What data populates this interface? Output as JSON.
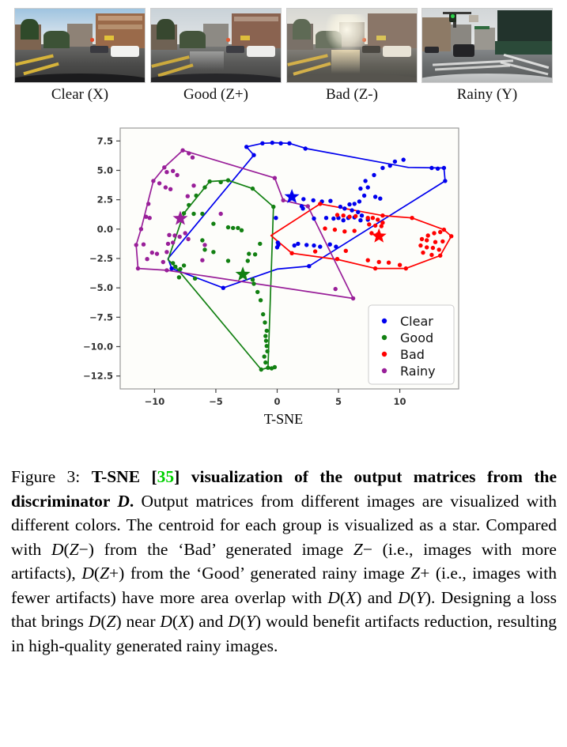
{
  "figure": {
    "label": "Figure 3:",
    "caption_bold": "T-SNE [35] visualization of the output matrices from the discriminator D.",
    "citation": "35",
    "caption_rest": "Output matrices from different images are visualized with different colors. The centroid for each group is visualized as a star. Compared with D(Z-) from the 'Bad' generated image Z- (i.e., images with more artifacts), D(Z+) from the 'Good' generated rainy image Z+ (i.e., images with fewer artifacts) have more area overlap with D(X) and D(Y). Designing a loss that brings D(Z) near D(X) and D(Y) would benefit artifacts reduction, resulting in high-quality generated rainy images."
  },
  "thumbnails": [
    {
      "label": "Clear (X)",
      "scene": "clear-daylight-city-street"
    },
    {
      "label": "Good (Z+)",
      "scene": "good-generated-rainy-street"
    },
    {
      "label": "Bad (Z-)",
      "scene": "bad-generated-rainy-street-artifacts"
    },
    {
      "label": "Rainy (Y)",
      "scene": "real-rainy-city-intersection"
    }
  ],
  "colors": {
    "clear": "#0000ee",
    "good": "#128012",
    "bad": "#ff0000",
    "rainy": "#991f99",
    "axis": "#444444",
    "frame": "#9a9a9a",
    "citation": "#00d000"
  },
  "chart_data": {
    "type": "scatter",
    "title": "",
    "xlabel": "T-SNE",
    "ylabel": "",
    "xlim": [
      -12.8,
      14.8
    ],
    "ylim": [
      -13.6,
      8.6
    ],
    "xticks": [
      -10,
      -5,
      0,
      5,
      10
    ],
    "yticks": [
      7.5,
      5.0,
      2.5,
      0.0,
      -2.5,
      -5.0,
      -7.5,
      -10.0,
      -12.5
    ],
    "grid": false,
    "legend_position": "lower right",
    "legend": [
      "Clear",
      "Good",
      "Bad",
      "Rainy"
    ],
    "series": [
      {
        "name": "Clear",
        "color": "#0000ee",
        "marker": "circle",
        "centroid": [
          1.2,
          2.75
        ],
        "hull": [
          [
            -1.9,
            6.3
          ],
          [
            -2.5,
            7.0
          ],
          [
            -1.2,
            7.3
          ],
          [
            -0.2,
            7.35
          ],
          [
            1.0,
            7.3
          ],
          [
            2.4,
            6.85
          ],
          [
            10.7,
            5.25
          ],
          [
            13.6,
            5.2
          ],
          [
            13.7,
            4.1
          ],
          [
            2.6,
            -3.15
          ],
          [
            0.0,
            -3.4
          ],
          [
            -4.4,
            -5.0
          ],
          [
            -8.6,
            -3.35
          ],
          [
            -8.9,
            -2.5
          ]
        ],
        "points": [
          [
            -2.5,
            7.0
          ],
          [
            -1.9,
            6.3
          ],
          [
            -1.2,
            7.3
          ],
          [
            -0.4,
            7.35
          ],
          [
            0.3,
            7.3
          ],
          [
            1.0,
            7.3
          ],
          [
            2.3,
            6.85
          ],
          [
            7.9,
            4.6
          ],
          [
            8.6,
            5.2
          ],
          [
            9.2,
            5.4
          ],
          [
            9.6,
            5.75
          ],
          [
            10.3,
            5.9
          ],
          [
            12.6,
            5.2
          ],
          [
            13.1,
            5.15
          ],
          [
            13.6,
            5.2
          ],
          [
            13.7,
            4.1
          ],
          [
            6.8,
            3.45
          ],
          [
            7.2,
            4.1
          ],
          [
            7.4,
            3.55
          ],
          [
            7.1,
            2.85
          ],
          [
            8.0,
            2.75
          ],
          [
            8.4,
            2.6
          ],
          [
            6.7,
            2.35
          ],
          [
            6.3,
            2.15
          ],
          [
            5.9,
            2.1
          ],
          [
            2.15,
            2.55
          ],
          [
            2.95,
            2.45
          ],
          [
            3.65,
            2.35
          ],
          [
            4.35,
            2.4
          ],
          [
            2.0,
            1.95
          ],
          [
            2.1,
            1.75
          ],
          [
            5.15,
            1.9
          ],
          [
            5.5,
            1.75
          ],
          [
            6.1,
            1.6
          ],
          [
            6.6,
            1.45
          ],
          [
            4.0,
            0.95
          ],
          [
            4.6,
            0.9
          ],
          [
            5.0,
            0.95
          ],
          [
            5.4,
            0.75
          ],
          [
            5.8,
            0.95
          ],
          [
            6.3,
            1.0
          ],
          [
            6.9,
            1.15
          ],
          [
            6.8,
            0.75
          ],
          [
            7.4,
            0.8
          ],
          [
            3.0,
            0.9
          ],
          [
            -0.1,
            0.95
          ],
          [
            0.1,
            -1.35
          ],
          [
            0.0,
            -1.55
          ],
          [
            0.05,
            -1.15
          ],
          [
            1.4,
            -1.4
          ],
          [
            1.7,
            -1.25
          ],
          [
            2.4,
            -1.35
          ],
          [
            3.0,
            -1.4
          ],
          [
            3.5,
            -1.5
          ],
          [
            4.3,
            -1.3
          ],
          [
            4.8,
            -1.5
          ],
          [
            2.6,
            -3.15
          ],
          [
            -4.4,
            -5.0
          ],
          [
            -8.6,
            -3.35
          ]
        ]
      },
      {
        "name": "Good",
        "color": "#128012",
        "marker": "circle",
        "centroid": [
          -2.8,
          -3.85
        ],
        "hull": [
          [
            -5.5,
            4.05
          ],
          [
            -4.0,
            4.15
          ],
          [
            -2.0,
            3.45
          ],
          [
            -0.3,
            1.9
          ],
          [
            -0.75,
            -11.8
          ],
          [
            -1.3,
            -11.95
          ],
          [
            -8.3,
            -3.2
          ],
          [
            -8.9,
            -2.6
          ],
          [
            -7.6,
            1.35
          ]
        ],
        "points": [
          [
            -5.5,
            4.05
          ],
          [
            -4.6,
            4.0
          ],
          [
            -4.0,
            4.15
          ],
          [
            -5.9,
            3.55
          ],
          [
            -6.6,
            2.85
          ],
          [
            -7.2,
            2.05
          ],
          [
            -7.6,
            1.35
          ],
          [
            -6.8,
            1.3
          ],
          [
            -6.1,
            1.3
          ],
          [
            -2.0,
            3.45
          ],
          [
            -0.3,
            1.9
          ],
          [
            -5.2,
            0.45
          ],
          [
            -4.0,
            0.15
          ],
          [
            -3.6,
            0.1
          ],
          [
            -3.2,
            0.1
          ],
          [
            -2.9,
            -0.1
          ],
          [
            -6.1,
            -0.95
          ],
          [
            -5.9,
            -1.75
          ],
          [
            -5.2,
            -1.95
          ],
          [
            -4.0,
            -2.7
          ],
          [
            -2.3,
            -2.1
          ],
          [
            -1.8,
            -2.15
          ],
          [
            -2.4,
            -2.7
          ],
          [
            -1.4,
            -1.25
          ],
          [
            -8.3,
            -3.2
          ],
          [
            -8.5,
            -2.9
          ],
          [
            -7.6,
            -3.1
          ],
          [
            -7.9,
            -3.4
          ],
          [
            -8.0,
            -4.1
          ],
          [
            -6.7,
            -4.2
          ],
          [
            -2.0,
            -4.3
          ],
          [
            -1.9,
            -4.65
          ],
          [
            -1.6,
            -5.35
          ],
          [
            -1.35,
            -6.05
          ],
          [
            -1.15,
            -7.25
          ],
          [
            -1.0,
            -7.95
          ],
          [
            -0.85,
            -8.65
          ],
          [
            -0.95,
            -9.1
          ],
          [
            -0.9,
            -9.5
          ],
          [
            -0.85,
            -9.95
          ],
          [
            -0.8,
            -10.4
          ],
          [
            -1.05,
            -10.85
          ],
          [
            -0.95,
            -11.35
          ],
          [
            -0.75,
            -11.8
          ],
          [
            -0.45,
            -11.85
          ],
          [
            -0.2,
            -11.75
          ],
          [
            -1.3,
            -11.95
          ]
        ]
      },
      {
        "name": "Bad",
        "color": "#ff0000",
        "marker": "circle",
        "centroid": [
          8.3,
          -0.6
        ],
        "hull": [
          [
            3.5,
            2.15
          ],
          [
            8.6,
            1.15
          ],
          [
            11.0,
            0.95
          ],
          [
            13.6,
            -0.05
          ],
          [
            14.2,
            -0.6
          ],
          [
            13.3,
            -2.25
          ],
          [
            10.5,
            -3.35
          ],
          [
            8.0,
            -3.35
          ],
          [
            5.0,
            -2.6
          ],
          [
            1.2,
            -2.05
          ],
          [
            -0.5,
            -0.55
          ]
        ],
        "points": [
          [
            3.5,
            2.15
          ],
          [
            4.9,
            1.2
          ],
          [
            5.4,
            1.15
          ],
          [
            5.9,
            1.05
          ],
          [
            6.4,
            1.1
          ],
          [
            8.6,
            1.15
          ],
          [
            7.4,
            0.95
          ],
          [
            7.8,
            0.95
          ],
          [
            8.2,
            0.8
          ],
          [
            8.6,
            0.55
          ],
          [
            7.5,
            0.4
          ],
          [
            8.0,
            0.3
          ],
          [
            8.5,
            0.25
          ],
          [
            11.0,
            0.95
          ],
          [
            3.9,
            0.05
          ],
          [
            4.7,
            -0.05
          ],
          [
            5.5,
            -0.2
          ],
          [
            6.3,
            -0.15
          ],
          [
            7.7,
            -0.35
          ],
          [
            8.2,
            -0.45
          ],
          [
            12.3,
            -0.55
          ],
          [
            12.8,
            -0.35
          ],
          [
            13.3,
            -0.25
          ],
          [
            13.6,
            -0.05
          ],
          [
            14.2,
            -0.6
          ],
          [
            11.8,
            -0.85
          ],
          [
            12.2,
            -0.95
          ],
          [
            12.9,
            -1.1
          ],
          [
            13.5,
            -1.05
          ],
          [
            11.7,
            -1.4
          ],
          [
            12.2,
            -1.55
          ],
          [
            12.7,
            -1.6
          ],
          [
            13.2,
            -1.75
          ],
          [
            1.2,
            -2.05
          ],
          [
            3.1,
            -1.9
          ],
          [
            5.6,
            -1.85
          ],
          [
            11.9,
            -2.0
          ],
          [
            12.6,
            -2.2
          ],
          [
            13.3,
            -2.25
          ],
          [
            4.9,
            -2.55
          ],
          [
            7.4,
            -2.65
          ],
          [
            8.3,
            -2.8
          ],
          [
            9.1,
            -2.85
          ],
          [
            10.0,
            -3.05
          ],
          [
            10.5,
            -3.35
          ],
          [
            8.0,
            -3.35
          ]
        ]
      },
      {
        "name": "Rainy",
        "color": "#991f99",
        "marker": "circle",
        "centroid": [
          -7.9,
          0.9
        ],
        "hull": [
          [
            -7.7,
            6.7
          ],
          [
            -0.2,
            4.35
          ],
          [
            0.5,
            2.45
          ],
          [
            2.5,
            1.95
          ],
          [
            6.2,
            -5.9
          ],
          [
            -9.0,
            -3.5
          ],
          [
            -11.35,
            -3.35
          ],
          [
            -11.5,
            -1.35
          ],
          [
            -11.1,
            0.0
          ],
          [
            -10.1,
            4.1
          ],
          [
            -9.2,
            5.25
          ]
        ],
        "points": [
          [
            -7.7,
            6.7
          ],
          [
            -7.2,
            6.45
          ],
          [
            -6.9,
            6.1
          ],
          [
            -9.2,
            5.25
          ],
          [
            -9.0,
            4.85
          ],
          [
            -8.5,
            4.95
          ],
          [
            -8.15,
            4.6
          ],
          [
            -10.1,
            4.1
          ],
          [
            -9.6,
            3.9
          ],
          [
            -9.1,
            3.55
          ],
          [
            -8.7,
            3.4
          ],
          [
            -6.8,
            3.7
          ],
          [
            -7.3,
            2.8
          ],
          [
            -10.5,
            2.15
          ],
          [
            -10.7,
            1.05
          ],
          [
            -10.4,
            0.95
          ],
          [
            -11.1,
            0.0
          ],
          [
            -8.8,
            -0.5
          ],
          [
            -8.35,
            -0.55
          ],
          [
            -7.95,
            -0.65
          ],
          [
            -7.5,
            -0.35
          ],
          [
            -10.9,
            -1.3
          ],
          [
            -11.5,
            -1.35
          ],
          [
            -8.9,
            -1.25
          ],
          [
            -8.5,
            -1.15
          ],
          [
            -7.25,
            -0.85
          ],
          [
            -10.2,
            -2.0
          ],
          [
            -9.8,
            -2.1
          ],
          [
            -9.0,
            -1.95
          ],
          [
            -10.6,
            -2.55
          ],
          [
            -9.3,
            -2.8
          ],
          [
            -11.35,
            -3.35
          ],
          [
            -9.0,
            -3.5
          ],
          [
            -6.1,
            -2.65
          ],
          [
            -5.9,
            -1.35
          ],
          [
            -0.2,
            4.35
          ],
          [
            0.5,
            2.45
          ],
          [
            2.5,
            1.95
          ],
          [
            -4.6,
            1.3
          ],
          [
            4.75,
            -5.1
          ],
          [
            6.2,
            -5.9
          ]
        ]
      }
    ]
  }
}
